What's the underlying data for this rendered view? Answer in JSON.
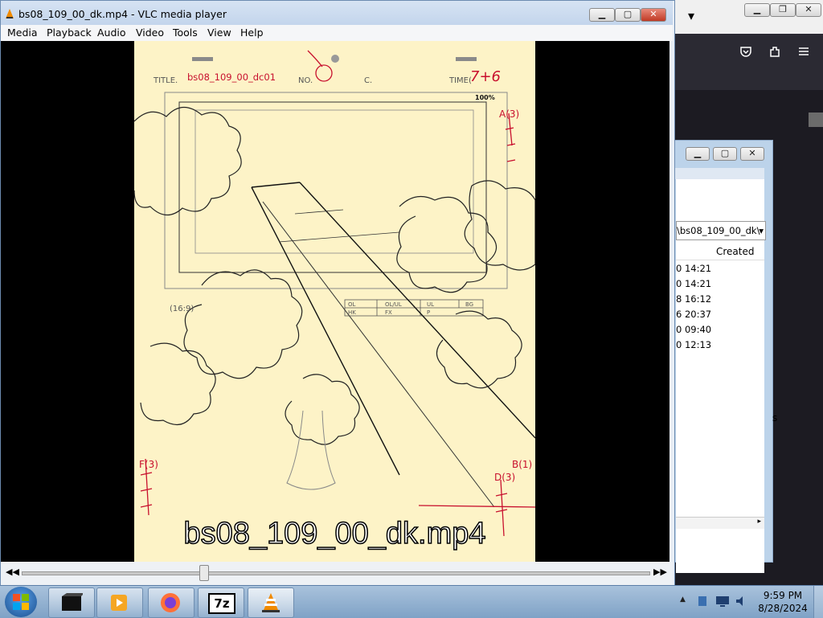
{
  "vlc": {
    "title": "bs08_109_00_dk.mp4 - VLC media player",
    "menu": [
      "Media",
      "Playback",
      "Audio",
      "Video",
      "Tools",
      "View",
      "Help"
    ],
    "subtitle": "bs08_109_00_dk.mp4",
    "seek_fraction": 0.29
  },
  "frame": {
    "title_label": "TITLE.",
    "title_value": "bs08_109_00_dc01",
    "no_label": "NO.",
    "c_label": "C.",
    "time_label": "TIME(",
    "time_value": "7+6",
    "pct": "100%",
    "ratio": "(16:9)",
    "a_mark": "A(3)",
    "b_mark": "B(1)",
    "f_mark": "F(3)",
    "d_mark": "D(3)",
    "grid": [
      "OL",
      "OL/UL",
      "UL",
      "BG",
      "HK",
      "FX",
      "P"
    ]
  },
  "explorer": {
    "path": "\\bs08_109_00_dk\\",
    "column": "Created",
    "rows": [
      "0 14:21",
      "0 14:21",
      "8 16:12",
      "6 20:37",
      "0 09:40",
      "0 12:13"
    ],
    "side_char": "s"
  },
  "firefox": {
    "chevron": "⌄"
  },
  "taskbar": {
    "time": "9:59 PM",
    "date": "8/28/2024",
    "apps": [
      "start-orb",
      "terminal",
      "media-player",
      "firefox",
      "7zip",
      "vlc"
    ],
    "labels": {
      "7zip": "7z"
    }
  },
  "colors": {
    "paper": "#fdf3c7",
    "red_ink": "#c8102e"
  }
}
